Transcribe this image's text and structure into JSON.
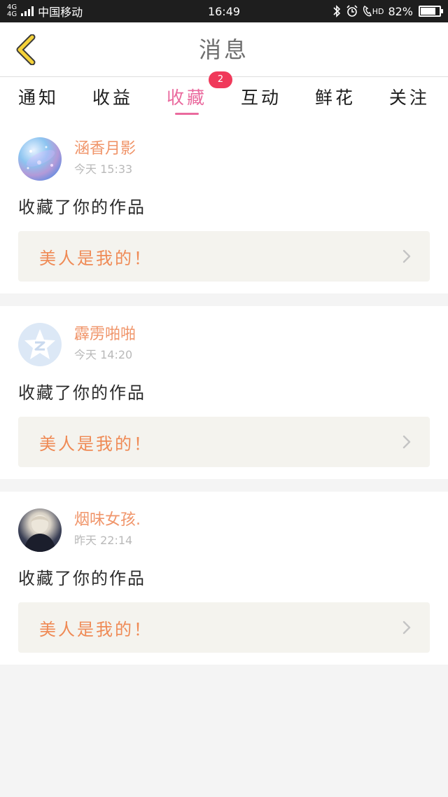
{
  "status_bar": {
    "network_primary": "4G",
    "network_secondary": "4G",
    "carrier": "中国移动",
    "time": "16:49",
    "hd_label": "HD",
    "battery_text": "82%",
    "battery_level": 0.82,
    "icons": [
      "bluetooth-icon",
      "alarm-icon",
      "hd-call-icon",
      "battery-icon"
    ]
  },
  "header": {
    "back_icon": "chevron-left-icon",
    "back_color": "#f5d23a",
    "title": "消息"
  },
  "tabs": [
    {
      "label": "通知"
    },
    {
      "label": "收益"
    },
    {
      "label": "收藏",
      "active": true,
      "badge": "2"
    },
    {
      "label": "互动"
    },
    {
      "label": "鲜花"
    },
    {
      "label": "关注"
    }
  ],
  "colors": {
    "accent": "#ea6a9e",
    "badge": "#f0395a",
    "username": "#f0956a",
    "work_title": "#ef8a55"
  },
  "notifications": [
    {
      "username": "涵香月影",
      "time": "今天 15:33",
      "action": "收藏了你的作品",
      "work_title": "美人是我的！",
      "avatar_icon": "galaxy-avatar"
    },
    {
      "username": "霹雳啪啪",
      "time": "今天 14:20",
      "action": "收藏了你的作品",
      "work_title": "美人是我的！",
      "avatar_icon": "qzone-star-icon"
    },
    {
      "username": "烟味女孩.",
      "time": "昨天 22:14",
      "action": "收藏了你的作品",
      "work_title": "美人是我的！",
      "avatar_icon": "photo-avatar"
    }
  ]
}
